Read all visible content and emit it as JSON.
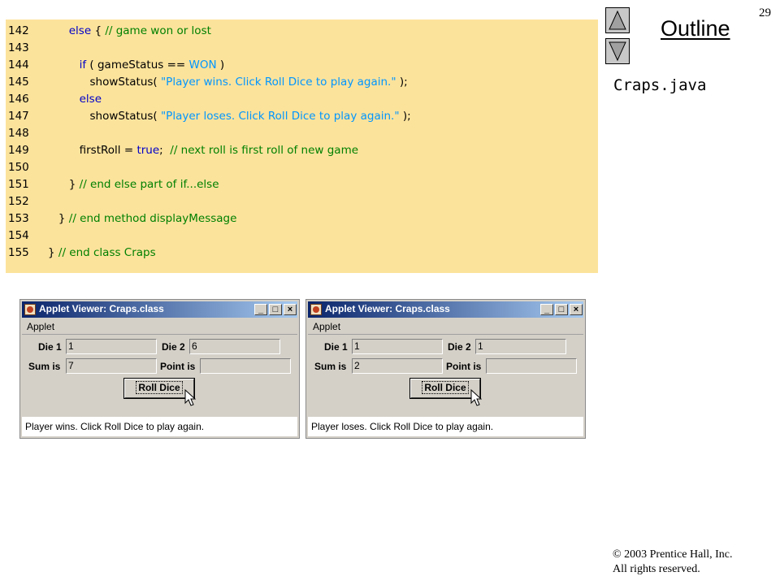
{
  "slide": {
    "page_number": "29",
    "outline_label": "Outline",
    "file_name": "Craps.java",
    "copyright_line1": "© 2003 Prentice Hall, Inc.",
    "copyright_line2": "All rights reserved."
  },
  "code": {
    "lines": [
      {
        "num": "142",
        "parts": [
          {
            "t": "      ",
            "c": "txt"
          },
          {
            "t": "else",
            "c": "kw"
          },
          {
            "t": " { ",
            "c": "txt"
          },
          {
            "t": "// game won or lost",
            "c": "cm"
          }
        ]
      },
      {
        "num": "143",
        "parts": []
      },
      {
        "num": "144",
        "parts": [
          {
            "t": "         ",
            "c": "txt"
          },
          {
            "t": "if",
            "c": "kw"
          },
          {
            "t": " ( gameStatus == ",
            "c": "txt"
          },
          {
            "t": "WON",
            "c": "con"
          },
          {
            "t": " )",
            "c": "txt"
          }
        ]
      },
      {
        "num": "145",
        "parts": [
          {
            "t": "            showStatus( ",
            "c": "txt"
          },
          {
            "t": "\"Player wins. Click Roll Dice to play again.\"",
            "c": "str"
          },
          {
            "t": " );",
            "c": "txt"
          }
        ]
      },
      {
        "num": "146",
        "parts": [
          {
            "t": "         ",
            "c": "txt"
          },
          {
            "t": "else",
            "c": "kw"
          }
        ]
      },
      {
        "num": "147",
        "parts": [
          {
            "t": "            showStatus( ",
            "c": "txt"
          },
          {
            "t": "\"Player loses. Click Roll Dice to play again.\"",
            "c": "str"
          },
          {
            "t": " );",
            "c": "txt"
          }
        ]
      },
      {
        "num": "148",
        "parts": []
      },
      {
        "num": "149",
        "parts": [
          {
            "t": "         firstRoll = ",
            "c": "txt"
          },
          {
            "t": "true",
            "c": "kw"
          },
          {
            "t": ";  ",
            "c": "txt"
          },
          {
            "t": "// next roll is first roll of new game",
            "c": "cm"
          }
        ]
      },
      {
        "num": "150",
        "parts": []
      },
      {
        "num": "151",
        "parts": [
          {
            "t": "      } ",
            "c": "txt"
          },
          {
            "t": "// end else part of if...else",
            "c": "cm"
          }
        ]
      },
      {
        "num": "152",
        "parts": []
      },
      {
        "num": "153",
        "parts": [
          {
            "t": "   } ",
            "c": "txt"
          },
          {
            "t": "// end method displayMessage",
            "c": "cm"
          }
        ]
      },
      {
        "num": "154",
        "parts": []
      },
      {
        "num": "155",
        "parts": [
          {
            "t": "} ",
            "c": "txt"
          },
          {
            "t": "// end class Craps",
            "c": "cm"
          }
        ]
      }
    ]
  },
  "applets": [
    {
      "title": "Applet Viewer: Craps.class",
      "menu": "Applet",
      "die1_label": "Die 1",
      "die1_value": "1",
      "die2_label": "Die 2",
      "die2_value": "6",
      "sum_label": "Sum is",
      "sum_value": "7",
      "point_label": "Point is",
      "point_value": "",
      "button_label": "Roll Dice",
      "status": "Player wins. Click Roll Dice to play again."
    },
    {
      "title": "Applet Viewer: Craps.class",
      "menu": "Applet",
      "die1_label": "Die 1",
      "die1_value": "1",
      "die2_label": "Die 2",
      "die2_value": "1",
      "sum_label": "Sum is",
      "sum_value": "2",
      "point_label": "Point is",
      "point_value": "",
      "button_label": "Roll Dice",
      "status": "Player loses. Click Roll Dice to play again."
    }
  ],
  "colors": {
    "code_background": "#fce39c",
    "keyword": "#0000c8",
    "comment": "#008000",
    "string": "#0096ff",
    "titlebar_start": "#0a246a",
    "titlebar_end": "#a6caf0"
  },
  "icons": {
    "nav_up": "triangle-up-icon",
    "nav_down": "triangle-down-icon",
    "cursor": "mouse-pointer-icon"
  }
}
